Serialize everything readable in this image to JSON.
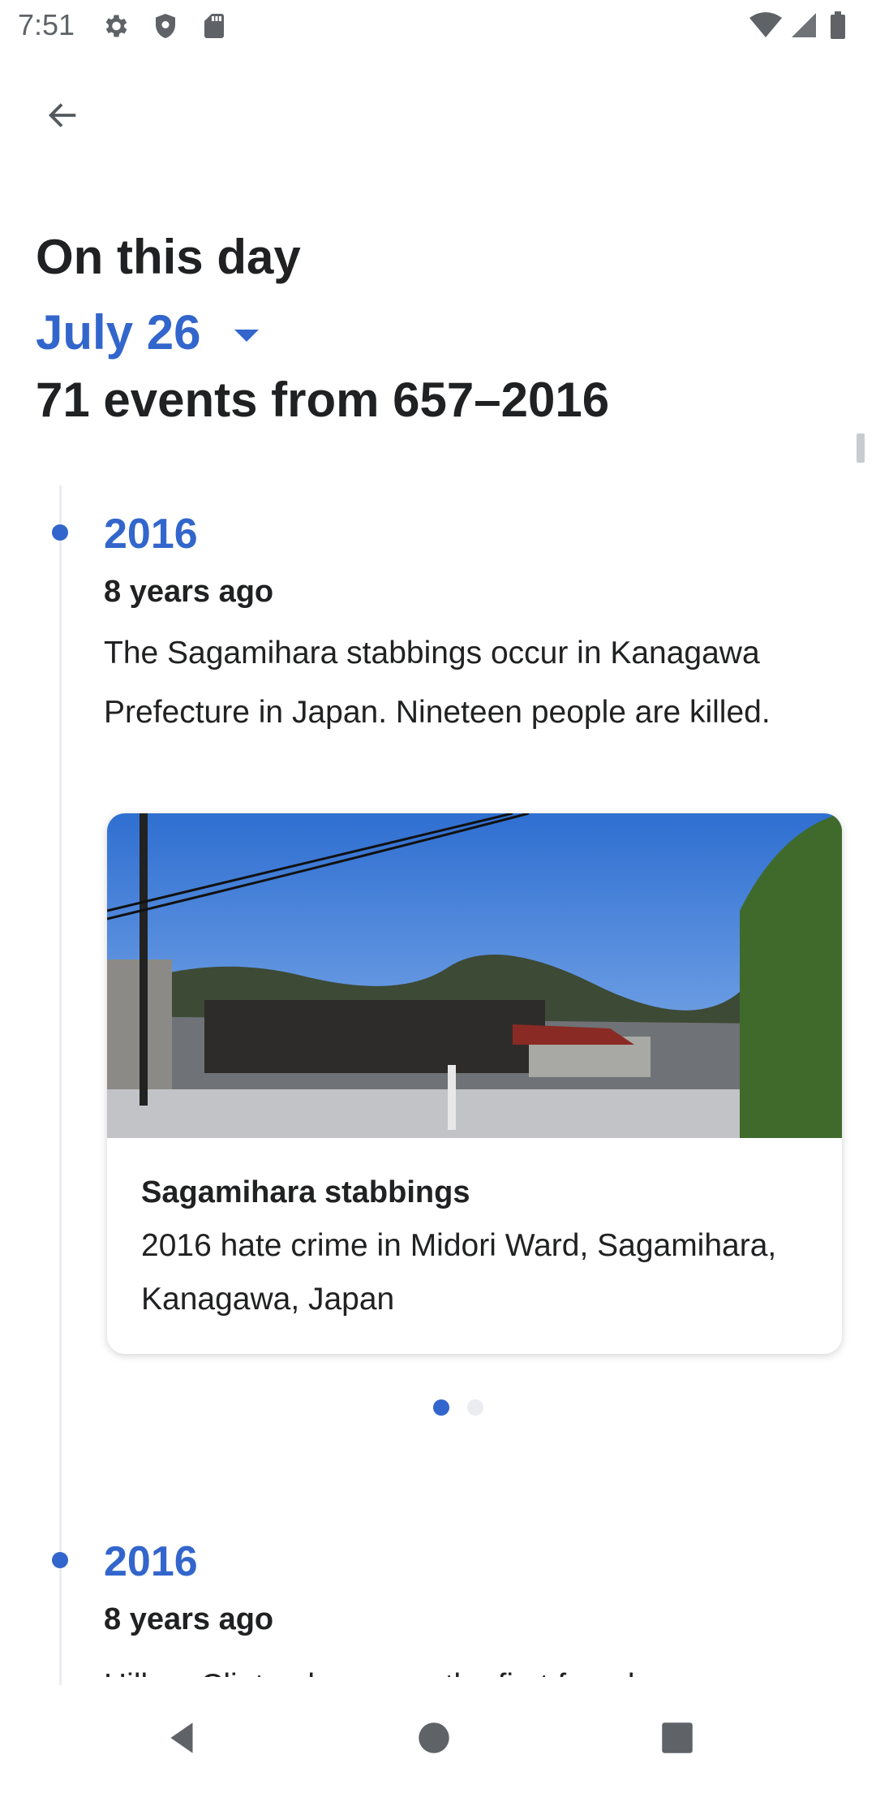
{
  "status_bar": {
    "time": "7:51",
    "icons_left": [
      "gear-icon",
      "shield-icon",
      "sd-card-icon"
    ],
    "icons_right": [
      "wifi-icon",
      "signal-icon",
      "battery-icon"
    ]
  },
  "header": {
    "title": "On this day",
    "date": "July 26",
    "events_summary": "71 events from 657–2016"
  },
  "events": [
    {
      "year": "2016",
      "ago": "8 years ago",
      "text": "The Sagamihara stabbings occur in Kanagawa Prefecture in Japan. Nineteen people are killed.",
      "card": {
        "title": "Sagamihara stabbings",
        "description": "2016 hate crime in Midori Ward, Sagamihara, Kanagawa, Japan"
      },
      "pager": {
        "current": 1,
        "total": 2
      }
    },
    {
      "year": "2016",
      "ago": "8 years ago",
      "text": "Hillary Clinton becomes the first female"
    }
  ],
  "colors": {
    "accent": "#3366cc",
    "text": "#202122",
    "timeline": "#eaecf0"
  }
}
